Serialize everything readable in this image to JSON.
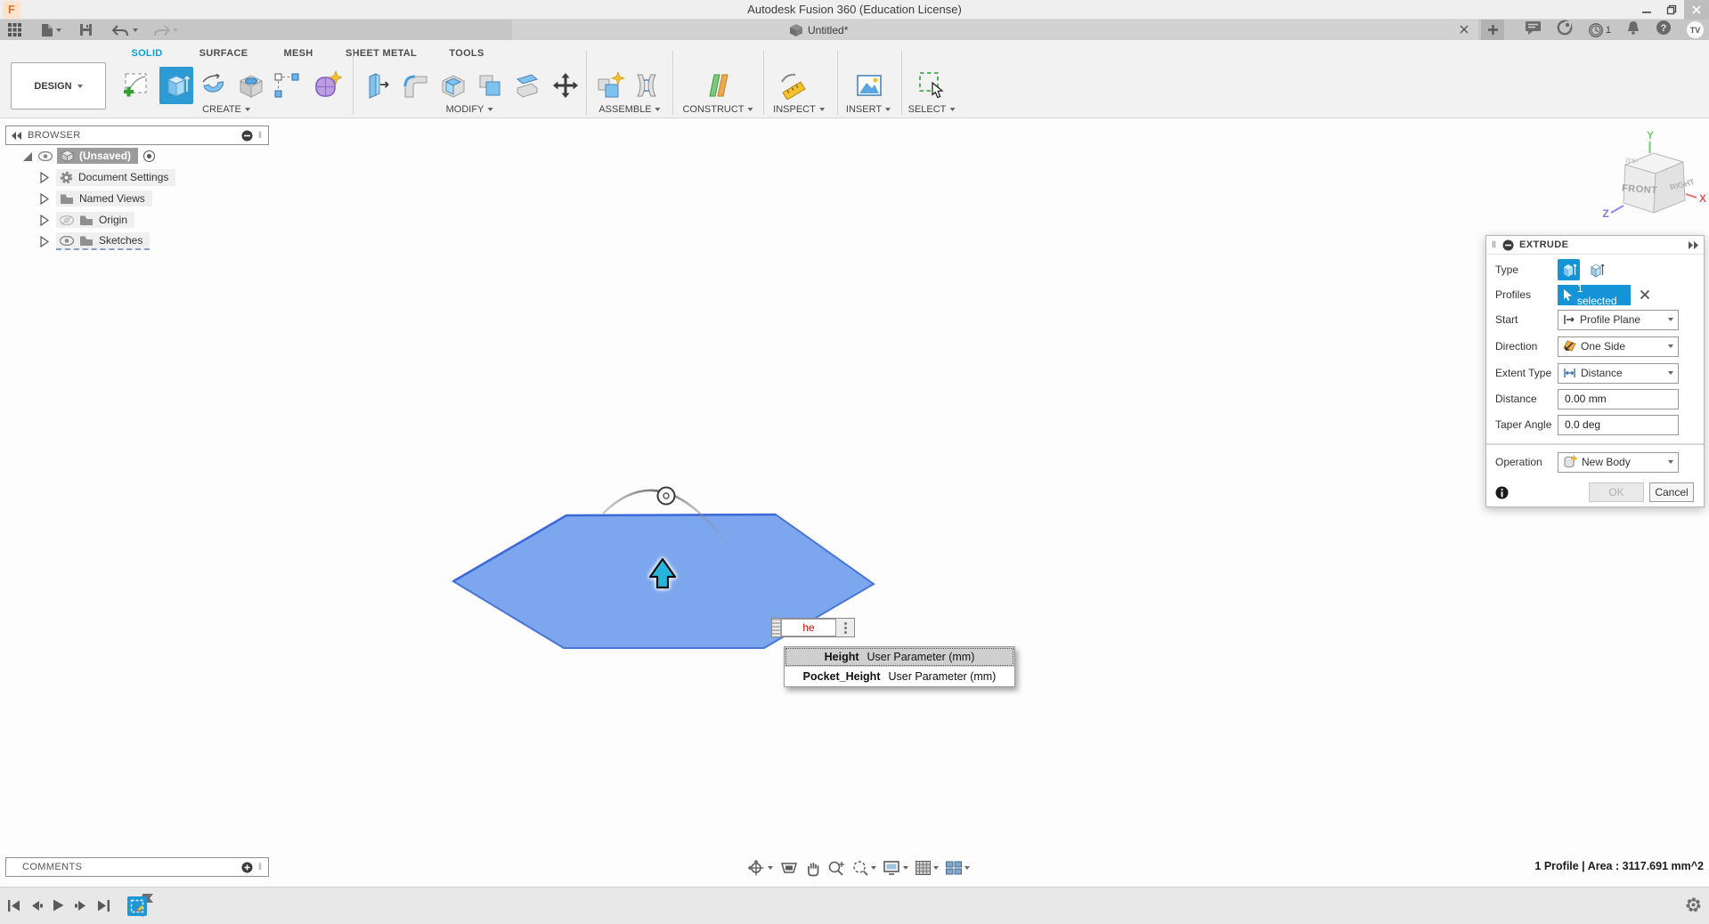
{
  "colors": {
    "accent": "#0696d7",
    "profile_fill": "#7ca6ee",
    "profile_edge": "#3d68d8",
    "manipulator": "#27b3dc",
    "input_text": "#e00000"
  },
  "titlebar": {
    "logo": "F",
    "title": "Autodesk Fusion 360 (Education License)"
  },
  "tabbar": {
    "document": "Untitled*",
    "job_count": "1",
    "help": "?",
    "avatar": "TV"
  },
  "ribbon": {
    "design": "DESIGN",
    "tabs": [
      "SOLID",
      "SURFACE",
      "MESH",
      "SHEET METAL",
      "TOOLS"
    ],
    "groups": [
      "CREATE",
      "MODIFY",
      "ASSEMBLE",
      "CONSTRUCT",
      "INSPECT",
      "INSERT",
      "SELECT"
    ]
  },
  "browser": {
    "title": "BROWSER",
    "root": "(Unsaved)",
    "items": [
      "Document Settings",
      "Named Views",
      "Origin",
      "Sketches"
    ]
  },
  "viewcube": {
    "front": "FRONT",
    "right": "RIGHT",
    "top": "TOP",
    "x": "X",
    "y": "Y",
    "z": "Z"
  },
  "canvas": {
    "dimension_value": "he"
  },
  "autocomplete": [
    {
      "name": "Height",
      "desc": "User Parameter (mm)"
    },
    {
      "name": "Pocket_Height",
      "desc": "User Parameter (mm)"
    }
  ],
  "extrude": {
    "title": "EXTRUDE",
    "type_label": "Type",
    "profiles_label": "Profiles",
    "profiles_value": "1 selected",
    "start_label": "Start",
    "start_value": "Profile Plane",
    "direction_label": "Direction",
    "direction_value": "One Side",
    "extent_label": "Extent Type",
    "extent_value": "Distance",
    "distance_label": "Distance",
    "distance_value": "0.00 mm",
    "taper_label": "Taper Angle",
    "taper_value": "0.0 deg",
    "operation_label": "Operation",
    "operation_value": "New Body",
    "ok": "OK",
    "cancel": "Cancel"
  },
  "comments": {
    "title": "COMMENTS"
  },
  "status": {
    "selection": "1 Profile | Area : 3117.691 mm^2"
  }
}
